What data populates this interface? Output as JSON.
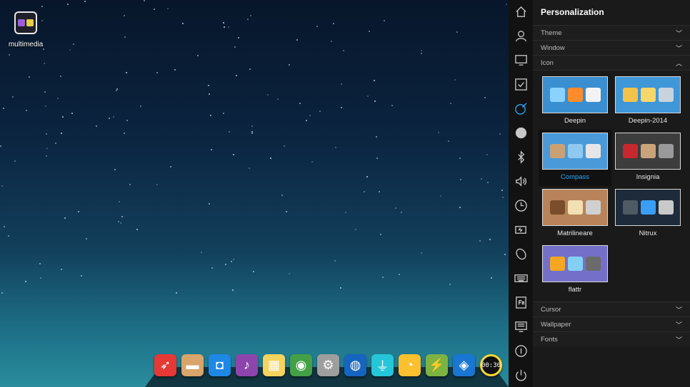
{
  "desktop": {
    "icon_label": "multimedia"
  },
  "dock": {
    "apps": [
      {
        "name": "launcher",
        "icon": "rocket-icon",
        "color": "#e53935"
      },
      {
        "name": "file-manager",
        "icon": "folder-icon",
        "color": "#d9a56b"
      },
      {
        "name": "app-store",
        "icon": "store-icon",
        "color": "#1e88e5"
      },
      {
        "name": "music",
        "icon": "music-icon",
        "color": "#8e44ad"
      },
      {
        "name": "video",
        "icon": "film-icon",
        "color": "#f4d35e"
      },
      {
        "name": "browser",
        "icon": "chrome-icon",
        "color": "#43a047"
      },
      {
        "name": "settings",
        "icon": "gear-icon",
        "color": "#9e9e9e"
      },
      {
        "name": "network",
        "icon": "globe-icon",
        "color": "#1565c0"
      },
      {
        "name": "usb",
        "icon": "usb-icon",
        "color": "#26c6da"
      },
      {
        "name": "disc",
        "icon": "disc-icon",
        "color": "#fbc02d"
      },
      {
        "name": "power",
        "icon": "bolt-icon",
        "color": "#7cb342"
      },
      {
        "name": "deepin-music",
        "icon": "deepin-icon",
        "color": "#1976d2"
      },
      {
        "name": "clock",
        "icon": "clock-icon",
        "color": "#fdd835"
      }
    ],
    "clock_text": "00:30"
  },
  "panel": {
    "title": "Personalization",
    "sections_top": [
      {
        "label": "Theme",
        "expanded": false
      },
      {
        "label": "Window",
        "expanded": false
      },
      {
        "label": "Icon",
        "expanded": true
      }
    ],
    "icon_themes": [
      {
        "name": "Deepin",
        "bg": "#3a8fd0",
        "colors": [
          "#8ad3ff",
          "#ff8c2a",
          "#f3f3f3"
        ]
      },
      {
        "name": "Deepin-2014",
        "bg": "#3f97d8",
        "colors": [
          "#f2c24a",
          "#f7d66a",
          "#c9d3dd"
        ]
      },
      {
        "name": "Compass",
        "bg": "#4a9ad9",
        "colors": [
          "#c9a175",
          "#8fc9f0",
          "#e6e6e6"
        ],
        "selected": true
      },
      {
        "name": "Insignia",
        "bg": "#3d3d3d",
        "colors": [
          "#c6282e",
          "#c9a47a",
          "#9a9a9a"
        ]
      },
      {
        "name": "Matrilineare",
        "bg": "#b8835a",
        "colors": [
          "#7a4e2a",
          "#f2dfb2",
          "#d0d0d0"
        ]
      },
      {
        "name": "Nitrux",
        "bg": "#1d2b3a",
        "colors": [
          "#505a64",
          "#3b9ef5",
          "#c9c9c9"
        ]
      },
      {
        "name": "flattr",
        "bg": "#7470c9",
        "colors": [
          "#f5a623",
          "#84d0f5",
          "#6b6b6b"
        ]
      }
    ],
    "sections_bottom": [
      {
        "label": "Cursor",
        "expanded": false
      },
      {
        "label": "Wallpaper",
        "expanded": false
      },
      {
        "label": "Fonts",
        "expanded": false
      }
    ]
  },
  "nav": [
    {
      "name": "home-icon"
    },
    {
      "name": "account-icon"
    },
    {
      "name": "display-icon"
    },
    {
      "name": "default-apps-icon"
    },
    {
      "name": "personalization-icon",
      "active": true
    },
    {
      "name": "network-icon"
    },
    {
      "name": "bluetooth-icon"
    },
    {
      "name": "sound-icon"
    },
    {
      "name": "datetime-icon"
    },
    {
      "name": "power-icon"
    },
    {
      "name": "mouse-icon"
    },
    {
      "name": "keyboard-icon"
    },
    {
      "name": "shortcuts-icon"
    },
    {
      "name": "system-info-icon"
    },
    {
      "name": "about-icon"
    },
    {
      "name": "shutdown-icon"
    }
  ],
  "colors": {
    "accent": "#2ca7f8"
  }
}
